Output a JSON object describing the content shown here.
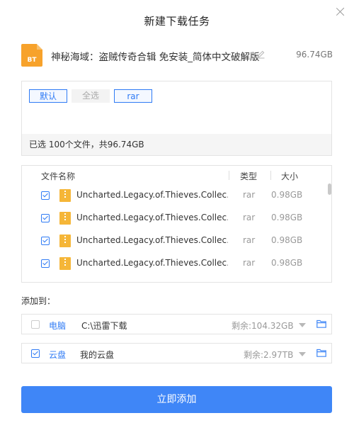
{
  "dialog": {
    "title": "新建下载任务"
  },
  "task": {
    "icon_label": "BT",
    "name": "神秘海域：盗贼传奇合辑 免安装_简体中文破解版",
    "size": "96.74GB"
  },
  "filters": {
    "tags": [
      "默认",
      "全选",
      "rar"
    ],
    "status": "已选 100个文件，共96.74GB"
  },
  "file_list": {
    "columns": {
      "name": "文件名称",
      "type": "类型",
      "size": "大小"
    },
    "rows": [
      {
        "name": "Uncharted.Legacy.of.Thieves.Collec…",
        "type": "rar",
        "size": "0.98GB",
        "checked": true
      },
      {
        "name": "Uncharted.Legacy.of.Thieves.Collec…",
        "type": "rar",
        "size": "0.98GB",
        "checked": true
      },
      {
        "name": "Uncharted.Legacy.of.Thieves.Collec…",
        "type": "rar",
        "size": "0.98GB",
        "checked": true
      },
      {
        "name": "Uncharted.Legacy.of.Thieves.Collec…",
        "type": "rar",
        "size": "0.98GB",
        "checked": true
      }
    ]
  },
  "destinations": {
    "label": "添加到：",
    "items": [
      {
        "type": "电脑",
        "path": "C:\\迅雷下载",
        "free": "剩余:104.32GB",
        "checked": false
      },
      {
        "type": "云盘",
        "path": "我的云盘",
        "free": "剩余:2.97TB",
        "checked": true
      }
    ]
  },
  "submit": {
    "label": "立即添加"
  },
  "colors": {
    "accent": "#2f7bf5",
    "button": "#3f86f7",
    "bt_icon": "#f7a22b"
  }
}
